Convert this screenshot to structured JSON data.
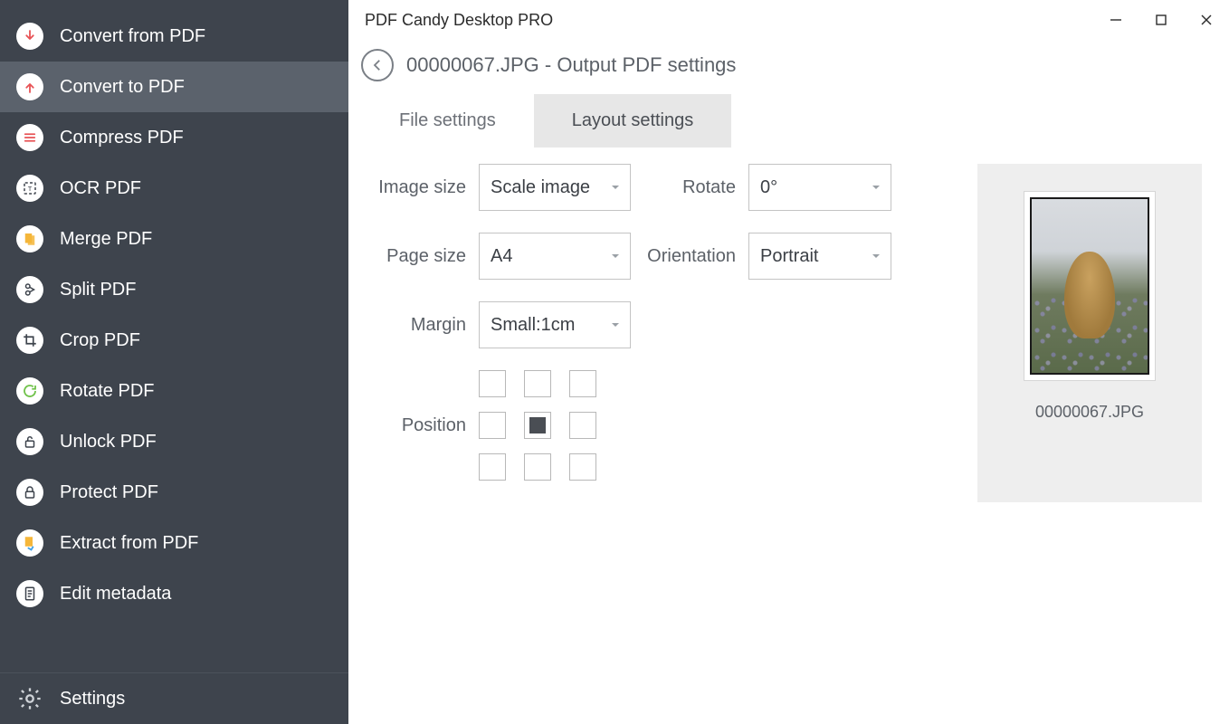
{
  "title": "PDF Candy Desktop PRO",
  "sidebar": {
    "items": [
      {
        "label": "Convert from PDF",
        "icon": "arrow-down",
        "color": "#e85356"
      },
      {
        "label": "Convert to PDF",
        "icon": "arrow-up",
        "color": "#e85356",
        "active": true
      },
      {
        "label": "Compress PDF",
        "icon": "compress",
        "color": "#e85356"
      },
      {
        "label": "OCR PDF",
        "icon": "ocr",
        "color": "#ffffff"
      },
      {
        "label": "Merge PDF",
        "icon": "merge",
        "color": "#f5b63a"
      },
      {
        "label": "Split PDF",
        "icon": "split",
        "color": "#3e444d"
      },
      {
        "label": "Crop PDF",
        "icon": "crop",
        "color": "#3e444d"
      },
      {
        "label": "Rotate PDF",
        "icon": "rotate",
        "color": "#6fc24a"
      },
      {
        "label": "Unlock PDF",
        "icon": "unlock",
        "color": "#3e444d"
      },
      {
        "label": "Protect PDF",
        "icon": "lock",
        "color": "#3e444d"
      },
      {
        "label": "Extract from PDF",
        "icon": "extract",
        "color": "#f5b63a"
      },
      {
        "label": "Edit metadata",
        "icon": "metadata",
        "color": "#3e444d"
      }
    ],
    "footer": {
      "label": "Settings"
    }
  },
  "header": {
    "breadcrumb": "00000067.JPG - Output PDF settings"
  },
  "tabs": [
    {
      "label": "File settings",
      "active": false
    },
    {
      "label": "Layout settings",
      "active": true
    }
  ],
  "form": {
    "image_size_label": "Image size",
    "image_size_value": "Scale image",
    "rotate_label": "Rotate",
    "rotate_value": "0°",
    "page_size_label": "Page size",
    "page_size_value": "A4",
    "orientation_label": "Orientation",
    "orientation_value": "Portrait",
    "margin_label": "Margin",
    "margin_value": "Small:1cm",
    "position_label": "Position",
    "position_selected_index": 4
  },
  "preview": {
    "caption": "00000067.JPG"
  }
}
